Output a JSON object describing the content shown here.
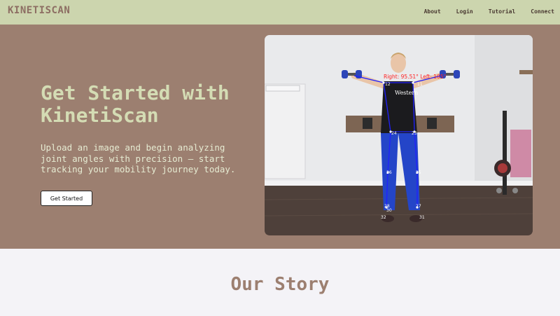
{
  "nav": {
    "brand": "KINETISCAN",
    "links": [
      "About",
      "Login",
      "Tutorial",
      "Connect"
    ]
  },
  "hero": {
    "title": "Get Started with KinetiScan",
    "subtitle": "Upload an image and begin analyzing joint angles with precision — start tracking your mobility journey today.",
    "cta_label": "Get Started",
    "photo": {
      "angle_label": "Right: 95.51° Left: 105°",
      "brand_text": "Western",
      "joint_labels": [
        "11",
        "12",
        "23",
        "24",
        "25",
        "26",
        "27",
        "28",
        "30",
        "31",
        "32"
      ]
    }
  },
  "story": {
    "title": "Our Story"
  },
  "colors": {
    "nav_bg": "#ccd5ae",
    "hero_bg": "#9c7f70",
    "accent_text": "#d4dcb4",
    "brand": "#8d6e63",
    "page_bg": "#f4f3f7"
  }
}
